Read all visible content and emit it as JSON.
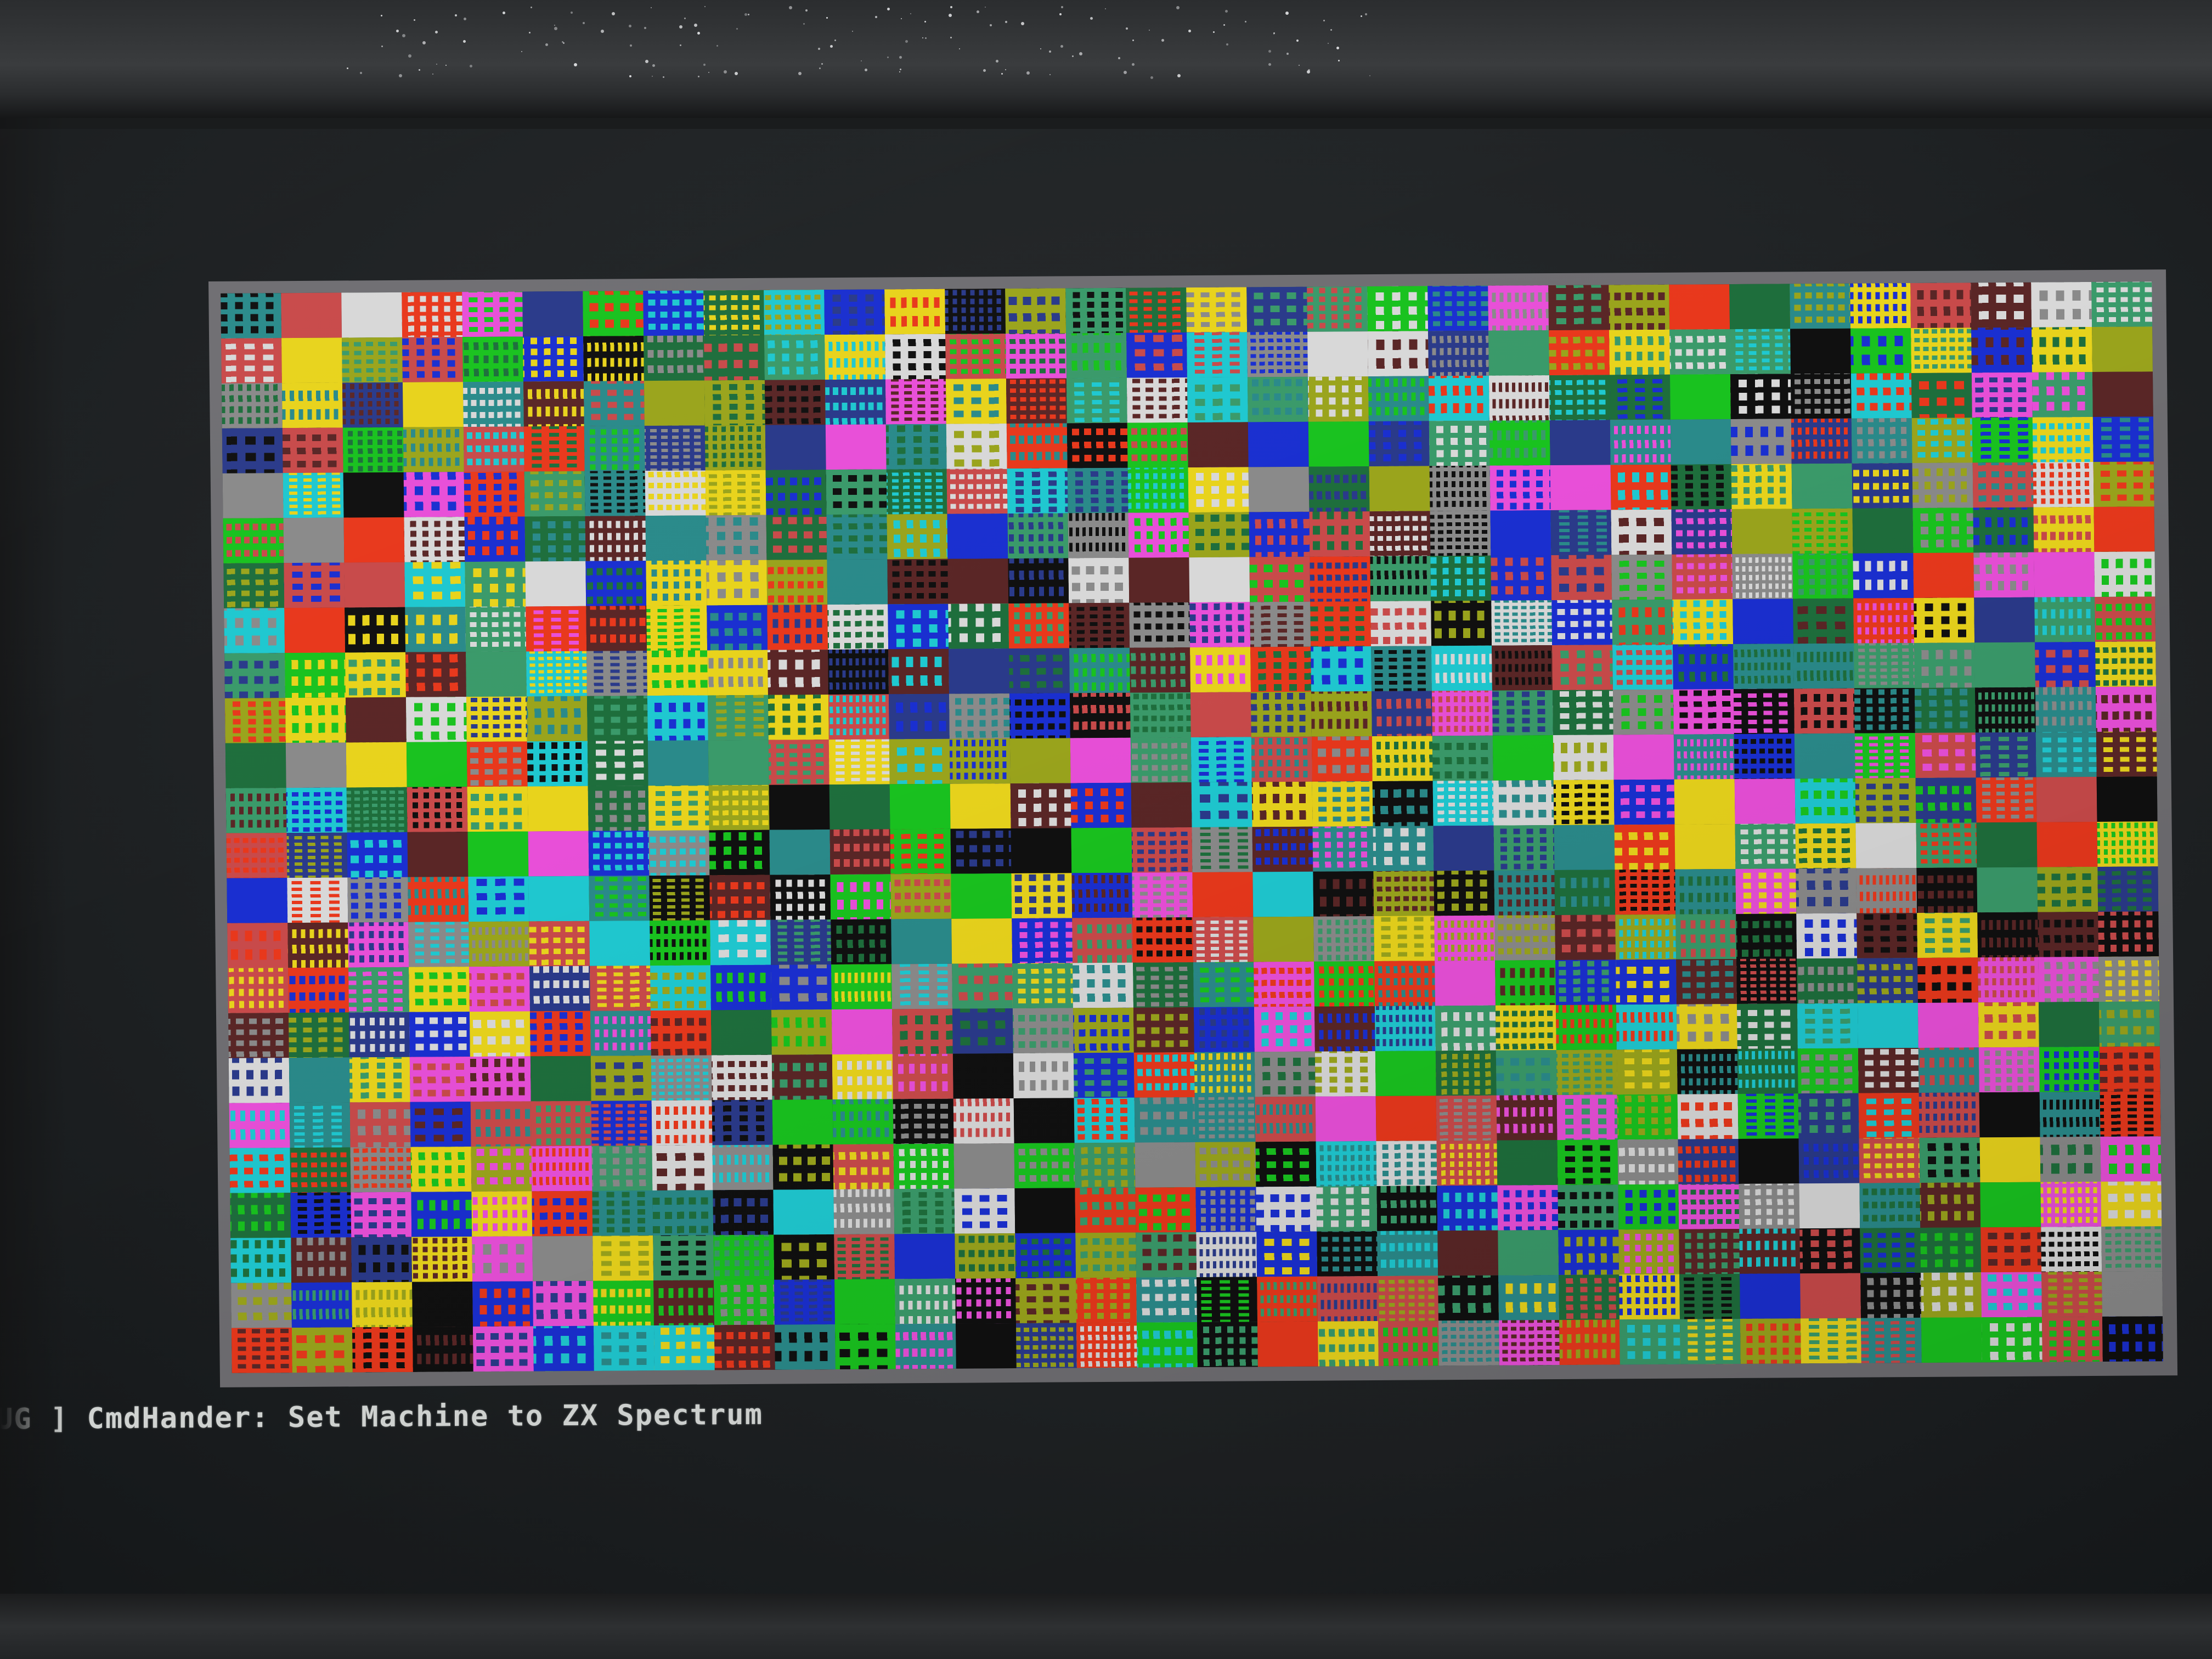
{
  "scene": {
    "description_free": true,
    "console_log": "UG ] CmdHander: Set Machine to ZX Spectrum"
  },
  "palette": {
    "bezel": "#2e3032",
    "screen_bg": "#1f2224",
    "emulator_border": "#6f6e72",
    "log_text": "#d8dbd9",
    "zx_colors": [
      "#101010",
      "#1a2fd0",
      "#e8381c",
      "#e84fd8",
      "#19c21f",
      "#1fc8d0",
      "#e8d31c",
      "#d8d8d8",
      "#1e6e3c",
      "#5a2626",
      "#2a8a8a",
      "#9aa41c",
      "#2a3a8a",
      "#c84a4a",
      "#8a8a8a",
      "#3a9a6a"
    ]
  },
  "grid": {
    "columns": 32,
    "rows": 24
  },
  "icons": {
    "monitor": "monitor-bezel",
    "display": "zx-spectrum-garbage-screen"
  }
}
